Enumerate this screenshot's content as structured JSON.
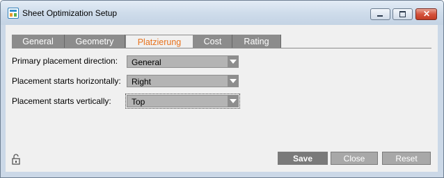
{
  "window": {
    "title": "Sheet Optimization Setup"
  },
  "tabs": [
    {
      "label": "General",
      "active": false
    },
    {
      "label": "Geometry",
      "active": false
    },
    {
      "label": "Platzierung",
      "active": true
    },
    {
      "label": "Cost",
      "active": false
    },
    {
      "label": "Rating",
      "active": false
    }
  ],
  "form": {
    "primary_direction": {
      "label": "Primary placement direction:",
      "value": "General"
    },
    "horizontal_start": {
      "label": "Placement starts horizontally:",
      "value": "Right"
    },
    "vertical_start": {
      "label": "Placement starts vertically:",
      "value": "Top"
    }
  },
  "buttons": {
    "save": "Save",
    "close": "Close",
    "reset": "Reset"
  },
  "icons": {
    "app": "sheet-app-icon",
    "lock": "unlocked-padlock-icon",
    "dropdown": "chevron-down-icon"
  },
  "colors": {
    "active_tab_text": "#e8721c",
    "tab_bg": "#8c8c8c",
    "title_bar": "#cddbea",
    "close_button": "#d5533d"
  }
}
